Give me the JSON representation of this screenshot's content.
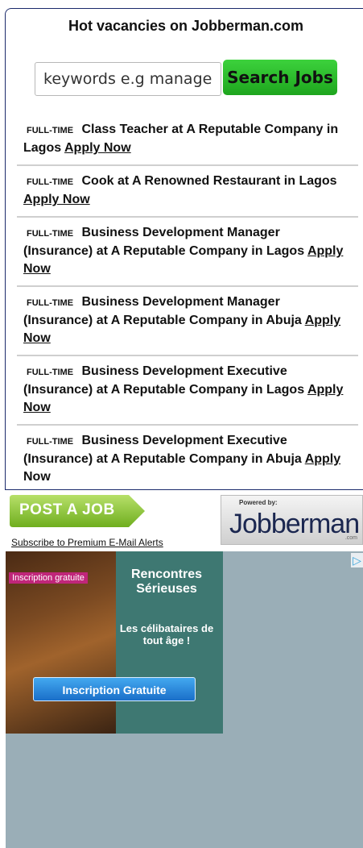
{
  "widget": {
    "title": "Hot vacancies on Jobberman.com",
    "search": {
      "placeholder": "keywords e.g manager",
      "button_label": "Search Jobs"
    },
    "jobs": [
      {
        "type": "FULL-TIME",
        "title": "Class Teacher at A Reputable Company in Lagos",
        "apply": "Apply Now"
      },
      {
        "type": "FULL-TIME",
        "title": "Cook at A Renowned Restaurant in Lagos",
        "apply": "Apply Now"
      },
      {
        "type": "FULL-TIME",
        "title": "Business Development Manager (Insurance) at A Reputable Company in Lagos",
        "apply": "Apply Now"
      },
      {
        "type": "FULL-TIME",
        "title": "Business Development Manager (Insurance) at A Reputable Company in Abuja",
        "apply": "Apply Now"
      },
      {
        "type": "FULL-TIME",
        "title": "Business Development Executive (Insurance) at A Reputable Company in Lagos",
        "apply": "Apply Now"
      },
      {
        "type": "FULL-TIME",
        "title": "Business Development Executive (Insurance) at A Reputable Company in Abuja",
        "apply": "Apply Now"
      }
    ]
  },
  "footer": {
    "post_job_label": "POST A JOB",
    "subscribe_label": "Subscribe to Premium E-Mail Alerts",
    "powered_by": "Powered by:",
    "logo_text": "Jobberman",
    "logo_suffix": ".com"
  },
  "ad": {
    "tag": "Inscription gratuite",
    "headline": "Rencontres Sérieuses",
    "subline": "Les célibataires de tout âge !",
    "cta": "Inscription Gratuite",
    "choices_icon": "adchoices-icon"
  },
  "colors": {
    "green_button": "#22b022",
    "border_navy": "#1b2a6b",
    "ad_bg": "#9aaeb7",
    "ad_banner": "#3e7872"
  }
}
